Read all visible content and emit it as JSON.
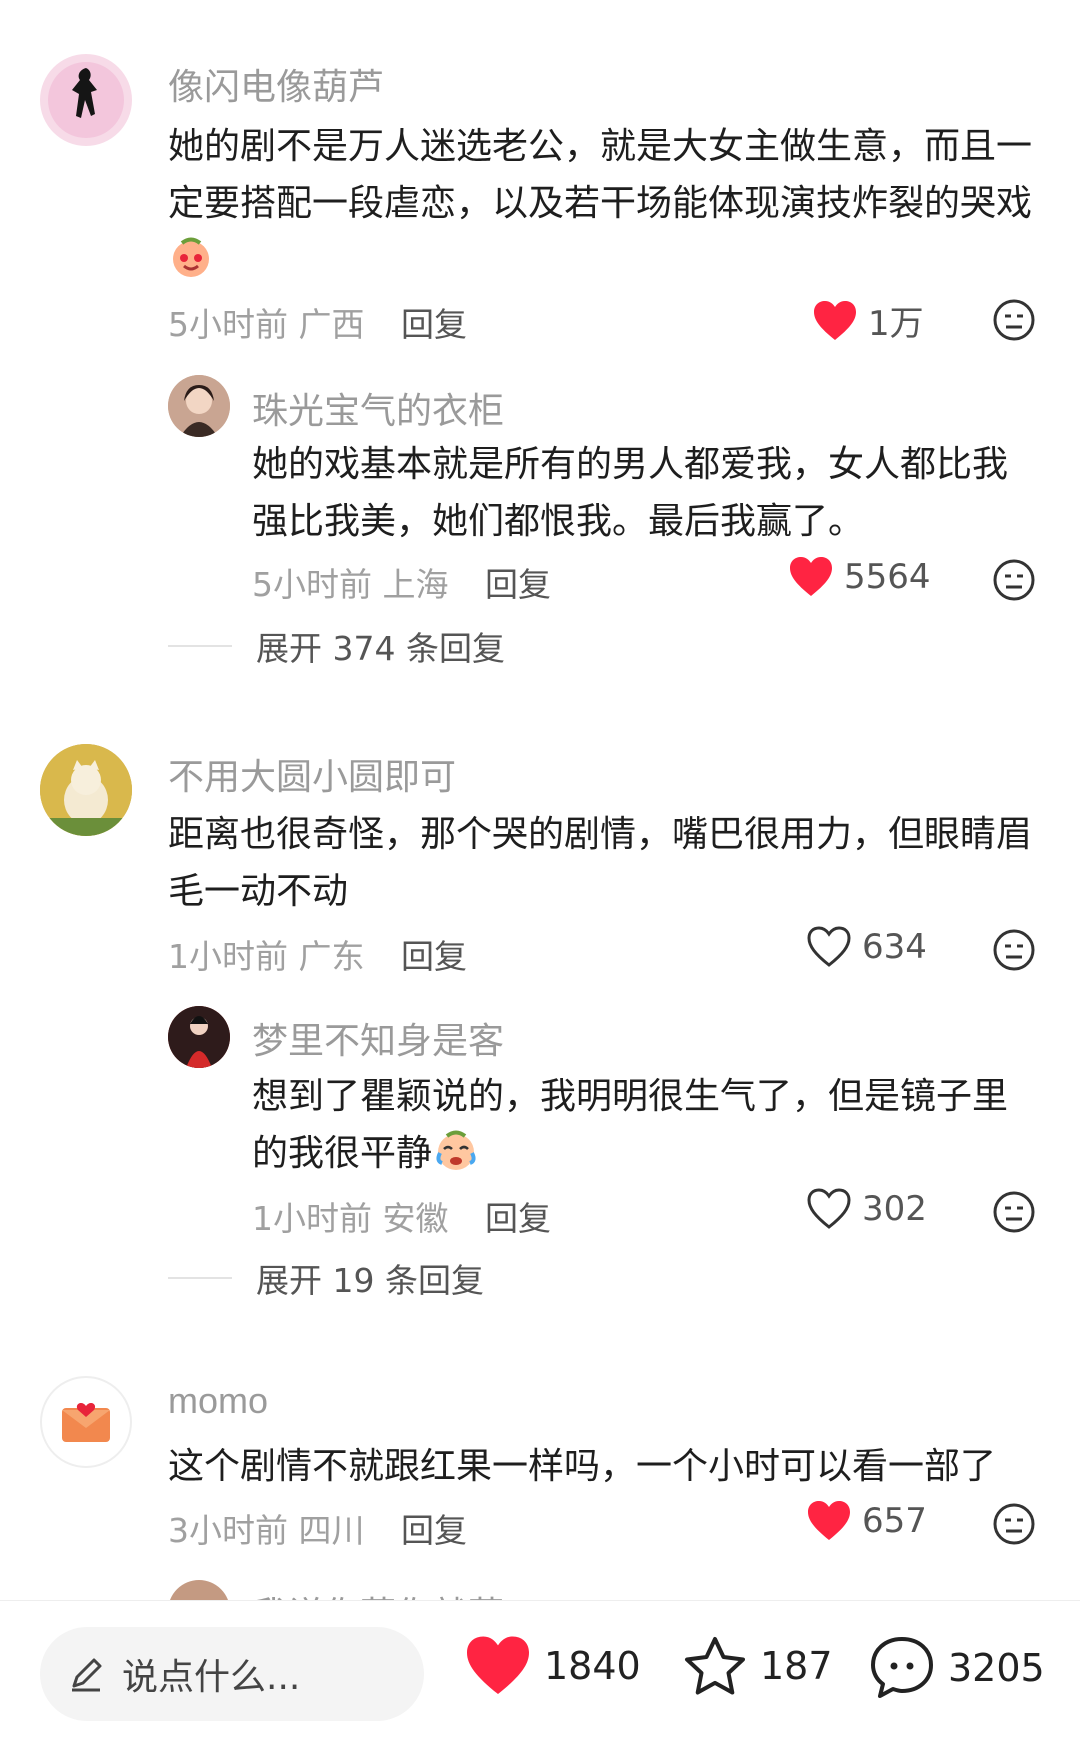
{
  "comments": [
    {
      "name": "像闪电像葫芦",
      "text": "她的剧不是万人迷选老公，就是大女主做生意，而且一定要搭配一段虐恋，以及若干场能体现演技炸裂的哭戏",
      "time": "5小时前",
      "location": "广西",
      "reply_label": "回复",
      "likes": "1万",
      "liked": true,
      "replies": [
        {
          "name": "珠光宝气的衣柜",
          "text": "她的戏基本就是所有的男人都爱我，女人都比我强比我美，她们都恨我。最后我赢了。",
          "time": "5小时前",
          "location": "上海",
          "reply_label": "回复",
          "likes": "5564",
          "liked": true
        }
      ],
      "expand_label": "展开 374 条回复"
    },
    {
      "name": "不用大圆小圆即可",
      "text": "距离也很奇怪，那个哭的剧情，嘴巴很用力，但眼睛眉毛一动不动",
      "time": "1小时前",
      "location": "广东",
      "reply_label": "回复",
      "likes": "634",
      "liked": false,
      "replies": [
        {
          "name": "梦里不知身是客",
          "text": "想到了瞿颖说的，我明明很生气了，但是镜子里的我很平静",
          "time": "1小时前",
          "location": "安徽",
          "reply_label": "回复",
          "likes": "302",
          "liked": false
        }
      ],
      "expand_label": "展开 19 条回复"
    },
    {
      "name": "momo",
      "text": "这个剧情不就跟红果一样吗，一个小时可以看一部了",
      "time": "3小时前",
      "location": "四川",
      "reply_label": "回复",
      "likes": "657",
      "liked": true
    }
  ],
  "partial_next_name": "我说你菜你就菜",
  "bottom_bar": {
    "input_placeholder": "说点什么...",
    "likes": "1840",
    "favorites": "187",
    "comments": "3205"
  },
  "colors": {
    "like_red": "#ff2442",
    "name_gray": "#9a9a9a",
    "text": "#1e1e1e"
  },
  "icons": [
    "pencil-icon",
    "heart-icon",
    "star-icon",
    "chat-bubble-icon",
    "dislike-face-icon"
  ]
}
